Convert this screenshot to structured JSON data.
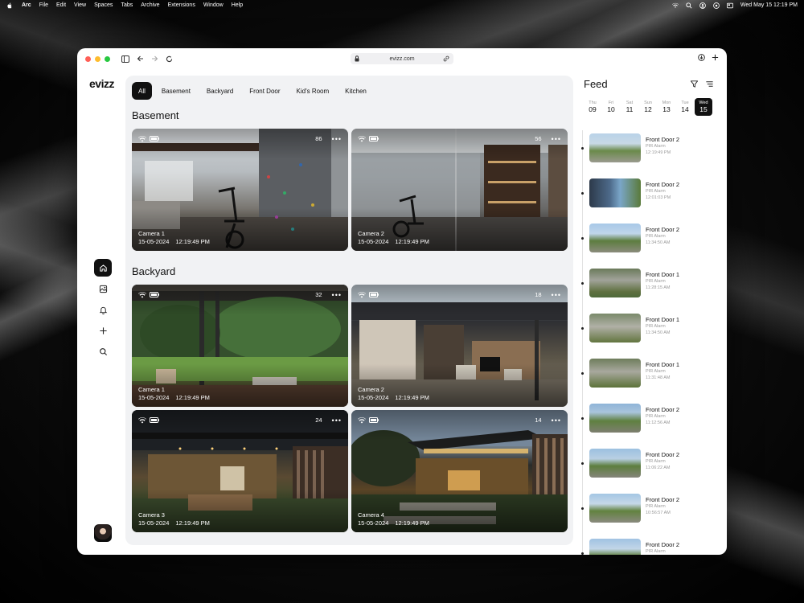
{
  "menubar": {
    "items": [
      "Arc",
      "File",
      "Edit",
      "View",
      "Spaces",
      "Tabs",
      "Archive",
      "Extensions",
      "Window",
      "Help"
    ],
    "datetime": "Wed May 15  12:19 PM"
  },
  "browser": {
    "url": "evizz.com"
  },
  "app": {
    "logo": "evizz"
  },
  "tabs": [
    "All",
    "Basement",
    "Backyard",
    "Front Door",
    "Kid's Room",
    "Kitchen"
  ],
  "sections": [
    {
      "title": "Basement",
      "cameras": [
        {
          "name": "Camera 1",
          "date": "15-05-2024",
          "time": "12:19:49 PM",
          "count": "86"
        },
        {
          "name": "Camera 2",
          "date": "15-05-2024",
          "time": "12:19:49 PM",
          "count": "56"
        }
      ]
    },
    {
      "title": "Backyard",
      "cameras": [
        {
          "name": "Camera 1",
          "date": "15-05-2024",
          "time": "12:19:49 PM",
          "count": "32"
        },
        {
          "name": "Camera 2",
          "date": "15-05-2024",
          "time": "12:19:49 PM",
          "count": "18"
        },
        {
          "name": "Camera 3",
          "date": "15-05-2024",
          "time": "12:19:49 PM",
          "count": "24"
        },
        {
          "name": "Camera 4",
          "date": "15-05-2024",
          "time": "12:19:49 PM",
          "count": "14"
        }
      ]
    }
  ],
  "feed": {
    "title": "Feed",
    "days": [
      {
        "name": "Thu",
        "date": "09"
      },
      {
        "name": "Fri",
        "date": "10"
      },
      {
        "name": "Sat",
        "date": "11"
      },
      {
        "name": "Sun",
        "date": "12"
      },
      {
        "name": "Mon",
        "date": "13"
      },
      {
        "name": "Tue",
        "date": "14"
      },
      {
        "name": "Wed",
        "date": "15"
      }
    ],
    "items": [
      {
        "camera": "Front Door 2",
        "type": "PIR Alarm",
        "time": "12:19:49 PM"
      },
      {
        "camera": "Front Door 2",
        "type": "PIR Alarm",
        "time": "12:01:03 PM"
      },
      {
        "camera": "Front Door 2",
        "type": "PIR Alarm",
        "time": "11:34:50 AM"
      },
      {
        "camera": "Front Door 1",
        "type": "PIR Alarm",
        "time": "11:28:15 AM"
      },
      {
        "camera": "Front Door 1",
        "type": "PIR Alarm",
        "time": "11:34:50 AM"
      },
      {
        "camera": "Front Door 1",
        "type": "PIR Alarm",
        "time": "11:31:48 AM"
      },
      {
        "camera": "Front Door 2",
        "type": "PIR Alarm",
        "time": "11:12:56 AM"
      },
      {
        "camera": "Front Door 2",
        "type": "PIR Alarm",
        "time": "11:06:22 AM"
      },
      {
        "camera": "Front Door 2",
        "type": "PIR Alarm",
        "time": "10:56:57 AM"
      },
      {
        "camera": "Front Door 2",
        "type": "PIR Alarm",
        "time": ""
      }
    ]
  }
}
